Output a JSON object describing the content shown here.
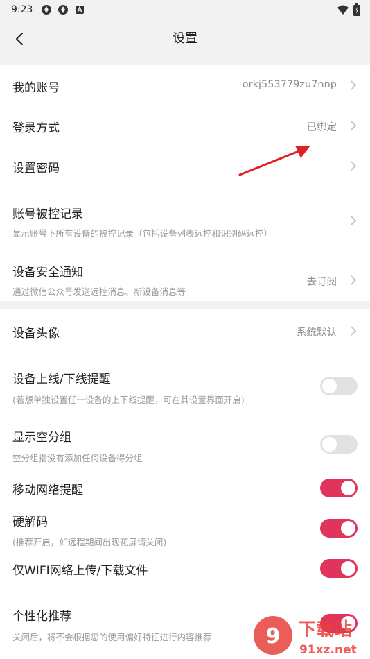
{
  "status_bar": {
    "time": "9:23"
  },
  "header": {
    "title": "设置"
  },
  "account": {
    "my_account": {
      "label": "我的账号",
      "value": "orkj553779zu7nnp"
    },
    "login_method": {
      "label": "登录方式",
      "value": "已绑定"
    },
    "set_password": {
      "label": "设置密码"
    },
    "controlled_records": {
      "label": "账号被控记录",
      "sub": "显示账号下所有设备的被控记录（包括设备列表远控和识别码远控）"
    },
    "security_notice": {
      "label": "设备安全通知",
      "sub": "通过微信公众号发送远控消息、新设备消息等",
      "value": "去订阅"
    }
  },
  "device": {
    "avatar": {
      "label": "设备头像",
      "value": "系统默认"
    },
    "online_alert": {
      "label": "设备上线/下线提醒",
      "sub": "(若想单独设置任一设备的上下线提醒，可在其设置界面开启)",
      "on": false
    },
    "show_empty_group": {
      "label": "显示空分组",
      "sub": "空分组指没有添加任何设备得分组",
      "on": false
    },
    "mobile_network_alert": {
      "label": "移动网络提醒",
      "on": true
    },
    "hw_decode": {
      "label": "硬解码",
      "sub": "(推荐开启，如远程期间出现花屏请关闭)",
      "on": true
    },
    "wifi_only": {
      "label": "仅WIFI网络上传/下载文件",
      "on": true
    },
    "personalized": {
      "label": "个性化推荐",
      "sub": "关闭后，将不会根据您的使用偏好特征进行内容推荐",
      "on": true
    }
  },
  "watermark": {
    "line1": "下载站",
    "line2": "91xz.net"
  },
  "colors": {
    "accent": "#e0345c",
    "annotation": "#e02020"
  }
}
